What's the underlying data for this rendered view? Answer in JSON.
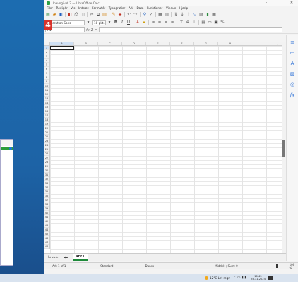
{
  "window": {
    "title": "Unavngivet 2 — LibreOffice Calc",
    "controls": [
      "–",
      "□",
      "✕"
    ]
  },
  "menu": [
    "Filer",
    "Redigér",
    "Vis",
    "Indsæt",
    "Formatér",
    "Typografier",
    "Ark",
    "Data",
    "Funktioner",
    "Vindue",
    "Hjælp"
  ],
  "format": {
    "font_name": "Liberation Sans",
    "font_size": "10 pkt.",
    "bold": "B",
    "italic": "I",
    "underline": "U"
  },
  "step_badge": "4",
  "formula": {
    "name_box": "A1",
    "fx": "fx",
    "sum": "Σ",
    "equals": "="
  },
  "columns": [
    "A",
    "B",
    "C",
    "D",
    "E",
    "F",
    "G",
    "H",
    "I",
    "J"
  ],
  "rows": [
    "1",
    "2",
    "3",
    "4",
    "5",
    "6",
    "7",
    "8",
    "9",
    "10",
    "11",
    "12",
    "13",
    "14",
    "15",
    "16",
    "17",
    "18",
    "19",
    "20",
    "21",
    "22",
    "23",
    "24",
    "25",
    "26",
    "27",
    "28",
    "29",
    "30",
    "31",
    "32",
    "33",
    "34",
    "35",
    "36",
    "37",
    "38",
    "39",
    "40",
    "41",
    "42",
    "43",
    "44",
    "45",
    "46",
    "47",
    "48"
  ],
  "active_cell": "A1",
  "sheet_tabs": {
    "nav": "I◂ ◂ ▸ ▸I",
    "add": "+",
    "sheets": [
      "Ark1"
    ]
  },
  "status": {
    "sheet": "Ark 1 of 1",
    "style": "Standard",
    "language": "Dansk",
    "sum": "Middel: ; Sum: 0",
    "zoom": "100 %"
  },
  "taskbar": {
    "weather": "12°C Let regn",
    "time": "10:43",
    "date": "25-11-2024"
  },
  "colors": {
    "accent": "#2ca046",
    "badge": "#d9322a",
    "selection": "#cfe0f4"
  }
}
